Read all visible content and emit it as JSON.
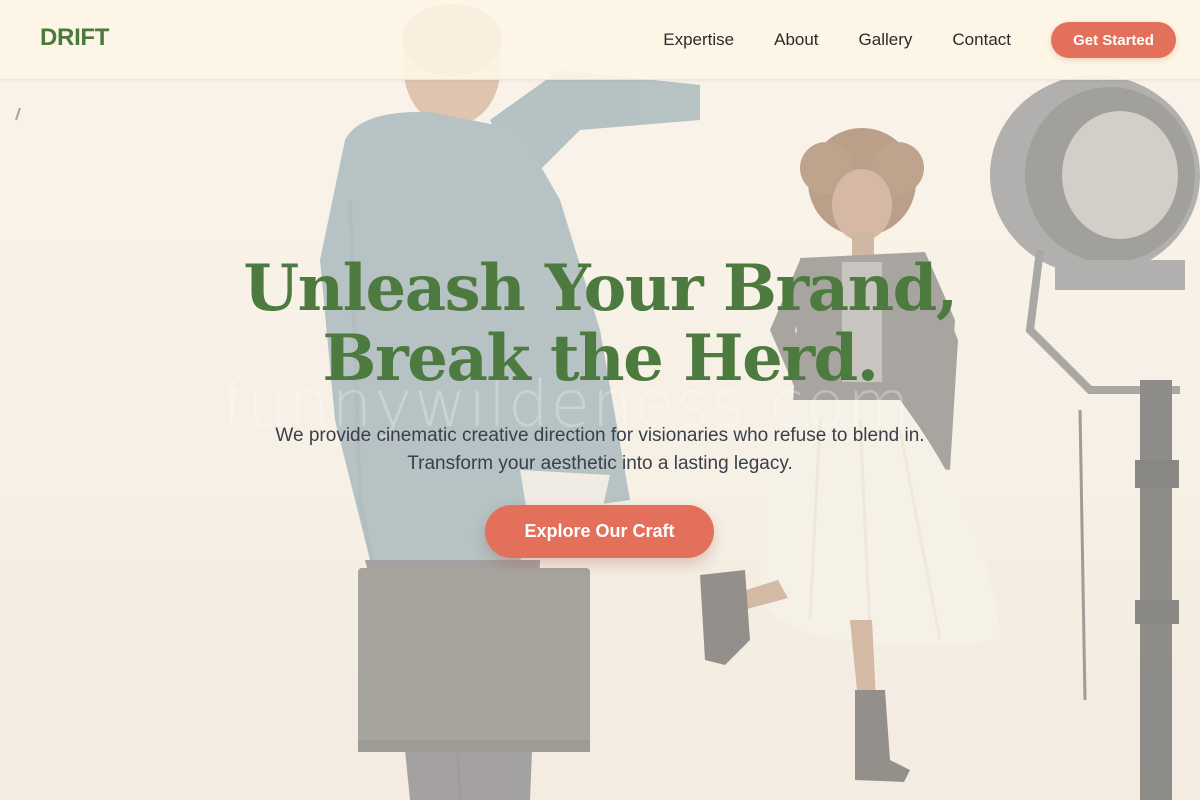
{
  "brand": {
    "logo_text": "DRIFT",
    "logo_color": "#4a7a3c"
  },
  "nav": {
    "links": [
      "Expertise",
      "About",
      "Gallery",
      "Contact"
    ],
    "cta_label": "Get Started"
  },
  "hero": {
    "title_line1": "Unleash Your Brand,",
    "title_line2": "Break the Herd.",
    "subtitle": "We provide cinematic creative direction for visionaries who refuse to blend in. Transform your aesthetic into a lasting legacy.",
    "cta_label": "Explore Our Craft",
    "watermark": "funnywildeness.com",
    "background_image": "photographer-with-model-studio-photo"
  },
  "colors": {
    "accent": "#e2705a",
    "headline": "#4d7a3e",
    "navbar_bg": "#fdf4e4",
    "body_text": "#3a3f4a"
  }
}
